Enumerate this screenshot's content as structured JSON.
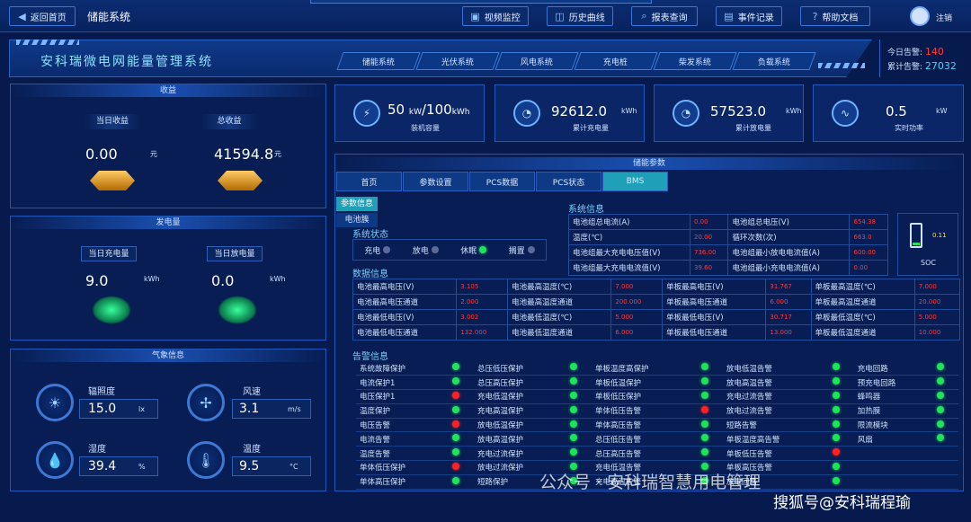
{
  "header": {
    "back_label": "返回首页",
    "system": "储能系统",
    "buttons": [
      "视频监控",
      "历史曲线",
      "报表查询",
      "事件记录",
      "帮助文档"
    ],
    "logout": "注销"
  },
  "title": "安科瑞微电网能量管理系统",
  "nav_tabs": [
    "储能系统",
    "光伏系统",
    "风电系统",
    "充电桩",
    "柴发系统",
    "负载系统"
  ],
  "alarms": {
    "today_label": "今日告警:",
    "today_value": "140",
    "total_label": "累计告警:",
    "total_value": "27032"
  },
  "income": {
    "title": "收益",
    "today_label": "当日收益",
    "today_value": "0.00",
    "total_label": "总收益",
    "total_value": "41594.8",
    "unit": "元"
  },
  "power": {
    "title": "发电量",
    "charge_label": "当日充电量",
    "charge_value": "9.0",
    "discharge_label": "当日放电量",
    "discharge_value": "0.0",
    "unit": "kWh"
  },
  "weather": {
    "title": "气象信息",
    "items": [
      {
        "label": "辐照度",
        "value": "15.0",
        "unit": "lx"
      },
      {
        "label": "风速",
        "value": "3.1",
        "unit": "m/s"
      },
      {
        "label": "湿度",
        "value": "39.4",
        "unit": "%"
      },
      {
        "label": "温度",
        "value": "9.5",
        "unit": "°C"
      }
    ]
  },
  "stats": [
    {
      "value": "50",
      "unit_a": "kW",
      "sep": "/100",
      "unit_b": "kWh",
      "label": "装机容量"
    },
    {
      "value": "92612.0",
      "unit": "kWh",
      "label": "累计充电量"
    },
    {
      "value": "57523.0",
      "unit": "kWh",
      "label": "累计放电量"
    },
    {
      "value": "0.5",
      "unit": "kW",
      "label": "实时功率"
    }
  ],
  "params": {
    "title": "储能参数",
    "tabs": [
      "首页",
      "参数设置",
      "PCS数据",
      "PCS状态",
      "BMS"
    ],
    "side_tabs": [
      "参数信息",
      "电池簇"
    ],
    "state_title": "系统状态",
    "states": [
      {
        "label": "充电",
        "on": false
      },
      {
        "label": "放电",
        "on": false
      },
      {
        "label": "休眠",
        "on": true
      },
      {
        "label": "搁置",
        "on": false
      }
    ],
    "sysinfo_title": "系统信息",
    "sysinfo": [
      [
        "电池组总电流(A)",
        "0.00",
        "电池组总电压(V)",
        "654.38"
      ],
      [
        "温度(℃)",
        "20.00",
        "循环次数(次)",
        "663.0"
      ],
      [
        "电池组最大充电电压值(V)",
        "736.00",
        "电池组最小放电电流值(A)",
        "600.00"
      ],
      [
        "电池组最大充电电流值(V)",
        "39.60",
        "电池组最小充电电流值(A)",
        "0.00"
      ]
    ],
    "soc_label": "SOC",
    "soc_value": "0.11",
    "data_title": "数据信息",
    "data": [
      [
        "电池最高电压(V)",
        "3.105",
        "电池最高温度(℃)",
        "7.000",
        "单板最高电压(V)",
        "31.767",
        "单板最高温度(℃)",
        "7.000"
      ],
      [
        "电池最高电压通道",
        "2.000",
        "电池最高温度通道",
        "200.000",
        "单板最高电压通道",
        "6.000",
        "单板最高温度通道",
        "20.000"
      ],
      [
        "电池最低电压(V)",
        "3.002",
        "电池最低温度(℃)",
        "5.000",
        "单板最低电压(V)",
        "30.717",
        "单板最低温度(℃)",
        "5.000"
      ],
      [
        "电池最低电压通道",
        "132.000",
        "电池最低温度通道",
        "6.000",
        "单板最低电压通道",
        "13.000",
        "单板最低温度通道",
        "10.000"
      ]
    ],
    "alarm_title": "告警信息",
    "alarm_rows": [
      [
        [
          "系统故障保护",
          "g"
        ],
        [
          "总压低压保护",
          "g"
        ],
        [
          "单板温度高保护",
          "g"
        ],
        [
          "放电低温告警",
          "g"
        ],
        [
          "充电回路",
          "g"
        ]
      ],
      [
        [
          "电流保护1",
          "g"
        ],
        [
          "总压高压保护",
          "g"
        ],
        [
          "单板低温保护",
          "g"
        ],
        [
          "放电高温告警",
          "g"
        ],
        [
          "预充电回路",
          "g"
        ]
      ],
      [
        [
          "电压保护1",
          "r"
        ],
        [
          "充电低温保护",
          "g"
        ],
        [
          "单板低压保护",
          "g"
        ],
        [
          "充电过流告警",
          "g"
        ],
        [
          "蜂鸣器",
          "g"
        ]
      ],
      [
        [
          "温度保护",
          "g"
        ],
        [
          "充电高温保护",
          "g"
        ],
        [
          "单体低压告警",
          "r"
        ],
        [
          "放电过流告警",
          "g"
        ],
        [
          "加热膜",
          "g"
        ]
      ],
      [
        [
          "电压告警",
          "r"
        ],
        [
          "放电低温保护",
          "g"
        ],
        [
          "单体高压告警",
          "g"
        ],
        [
          "短路告警",
          "g"
        ],
        [
          "限流模块",
          "g"
        ]
      ],
      [
        [
          "电流告警",
          "g"
        ],
        [
          "放电高温保护",
          "g"
        ],
        [
          "总压低压告警",
          "g"
        ],
        [
          "单板温度高告警",
          "g"
        ],
        [
          "风扇",
          "g"
        ]
      ],
      [
        [
          "温度告警",
          "g"
        ],
        [
          "充电过流保护",
          "g"
        ],
        [
          "总压高压告警",
          "g"
        ],
        [
          "单板低压告警",
          "r"
        ],
        [
          "",
          ""
        ]
      ],
      [
        [
          "单体低压保护",
          "r"
        ],
        [
          "放电过流保护",
          "g"
        ],
        [
          "充电低温告警",
          "g"
        ],
        [
          "单板高压告警",
          "g"
        ],
        [
          "",
          ""
        ]
      ],
      [
        [
          "单体高压保护",
          "g"
        ],
        [
          "短路保护",
          "g"
        ],
        [
          "充电高温告警",
          "g"
        ],
        [
          "放电回路",
          "g"
        ],
        [
          "",
          ""
        ]
      ]
    ]
  },
  "watermark": {
    "wechat": "公众号 · 安科瑞智慧用电管理",
    "sohu": "搜狐号@安科瑞程瑜"
  }
}
